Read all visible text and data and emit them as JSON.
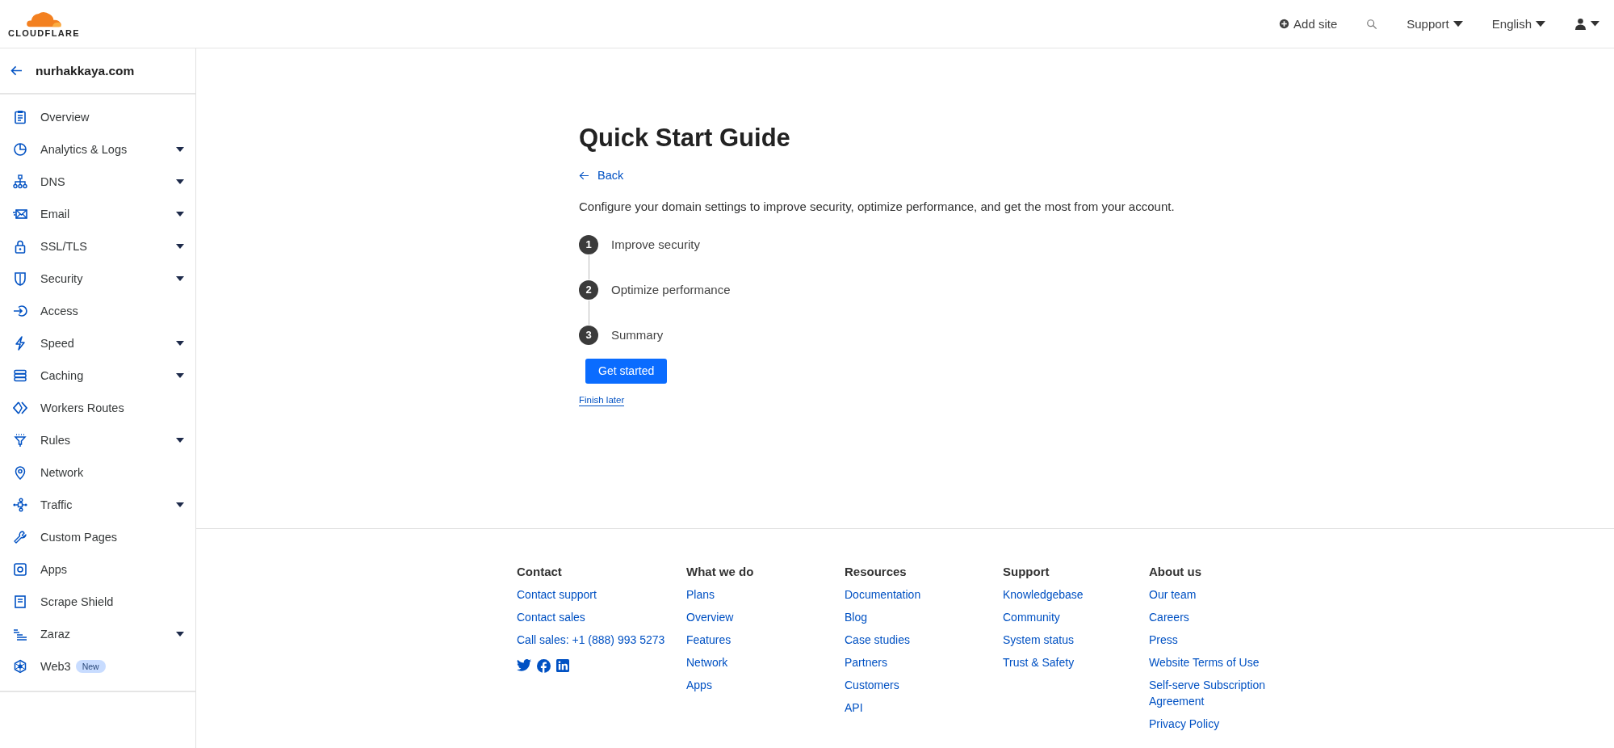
{
  "header": {
    "logo": "CLOUDFLARE",
    "add_site": "Add site",
    "support": "Support",
    "language": "English"
  },
  "sidebar": {
    "domain": "nurhakkaya.com",
    "items": [
      {
        "label": "Overview",
        "expandable": false
      },
      {
        "label": "Analytics & Logs",
        "expandable": true
      },
      {
        "label": "DNS",
        "expandable": true
      },
      {
        "label": "Email",
        "expandable": true
      },
      {
        "label": "SSL/TLS",
        "expandable": true
      },
      {
        "label": "Security",
        "expandable": true
      },
      {
        "label": "Access",
        "expandable": false
      },
      {
        "label": "Speed",
        "expandable": true
      },
      {
        "label": "Caching",
        "expandable": true
      },
      {
        "label": "Workers Routes",
        "expandable": false
      },
      {
        "label": "Rules",
        "expandable": true
      },
      {
        "label": "Network",
        "expandable": false
      },
      {
        "label": "Traffic",
        "expandable": true
      },
      {
        "label": "Custom Pages",
        "expandable": false
      },
      {
        "label": "Apps",
        "expandable": false
      },
      {
        "label": "Scrape Shield",
        "expandable": false
      },
      {
        "label": "Zaraz",
        "expandable": true
      },
      {
        "label": "Web3",
        "expandable": false,
        "badge": "New"
      }
    ]
  },
  "main": {
    "title": "Quick Start Guide",
    "back": "Back",
    "description": "Configure your domain settings to improve security, optimize performance, and get the most from your account.",
    "steps": [
      {
        "number": "1",
        "label": "Improve security"
      },
      {
        "number": "2",
        "label": "Optimize performance"
      },
      {
        "number": "3",
        "label": "Summary"
      }
    ],
    "primary_button": "Get started",
    "secondary_link": "Finish later"
  },
  "footer": {
    "columns": [
      {
        "heading": "Contact",
        "links": [
          "Contact support",
          "Contact sales",
          "Call sales: +1 (888) 993 5273"
        ]
      },
      {
        "heading": "What we do",
        "links": [
          "Plans",
          "Overview",
          "Features",
          "Network",
          "Apps"
        ]
      },
      {
        "heading": "Resources",
        "links": [
          "Documentation",
          "Blog",
          "Case studies",
          "Partners",
          "Customers",
          "API"
        ]
      },
      {
        "heading": "Support",
        "links": [
          "Knowledgebase",
          "Community",
          "System status",
          "Trust & Safety"
        ]
      },
      {
        "heading": "About us",
        "links": [
          "Our team",
          "Careers",
          "Press",
          "Website Terms of Use",
          "Self-serve Subscription Agreement",
          "Privacy Policy"
        ]
      }
    ]
  }
}
